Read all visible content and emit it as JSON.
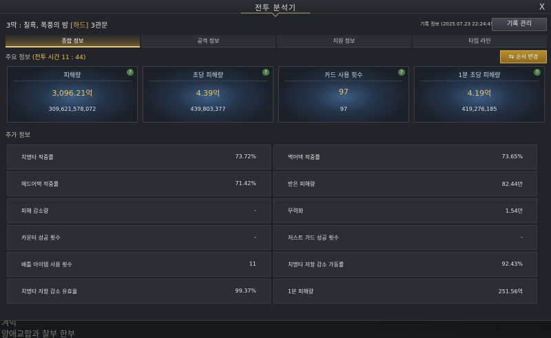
{
  "window": {
    "title": "전투 분석기",
    "close_label": "X"
  },
  "header": {
    "stage_prefix": "3막 : 칠흑, 폭풍의 밤",
    "difficulty": "[하드]",
    "stage_suffix": "3관문",
    "record_info": "기록 정보 (2025.07.23 22:24:45)",
    "record_button": "기록 관리"
  },
  "tabs": [
    {
      "label": "종합 정보",
      "active": true
    },
    {
      "label": "공격 정보",
      "active": false
    },
    {
      "label": "지원 정보",
      "active": false
    },
    {
      "label": "타임 라인",
      "active": false
    }
  ],
  "main_info": {
    "label": "주요 정보",
    "time": "(전투 시간 11 : 44)",
    "order_button": "순서 변경",
    "order_icon": "swap-icon"
  },
  "cards": [
    {
      "label": "피해량",
      "main": "3,096.21억",
      "sub": "309,621,578,072"
    },
    {
      "label": "초당 피해량",
      "main": "4.39억",
      "sub": "439,803,377"
    },
    {
      "label": "카드 사용 횟수",
      "main": "97",
      "sub": "97"
    },
    {
      "label": "1분 초당 피해량",
      "main": "4.19억",
      "sub": "419,276,185"
    }
  ],
  "extra_info": {
    "label": "추가 정보",
    "left": [
      {
        "name": "치명타 적중률",
        "value": "73.72%"
      },
      {
        "name": "헤드어택 적중률",
        "value": "71.42%"
      },
      {
        "name": "피해 감소량",
        "value": "-"
      },
      {
        "name": "카운터 성공 횟수",
        "value": "-"
      },
      {
        "name": "배틀 아이템 사용 횟수",
        "value": "11"
      },
      {
        "name": "치명타 저항 감소 유효율",
        "value": "99.37%"
      }
    ],
    "right": [
      {
        "name": "백어택 적중률",
        "value": "73.65%"
      },
      {
        "name": "받은 피해량",
        "value": "82.44만"
      },
      {
        "name": "무력화",
        "value": "1.54만"
      },
      {
        "name": "저스트 가드 성공 횟수",
        "value": "-"
      },
      {
        "name": "치명타 저항 감소 가동률",
        "value": "92.43%"
      },
      {
        "name": "1분 피해량",
        "value": "251.56억"
      }
    ]
  },
  "background": {
    "text_1": "겨익",
    "text_2": "양애교합과 찰부 한부"
  },
  "colors": {
    "accent_gold": "#f0c657",
    "tab_active_border": "#e9c878",
    "button_gold": "#b58d30"
  }
}
